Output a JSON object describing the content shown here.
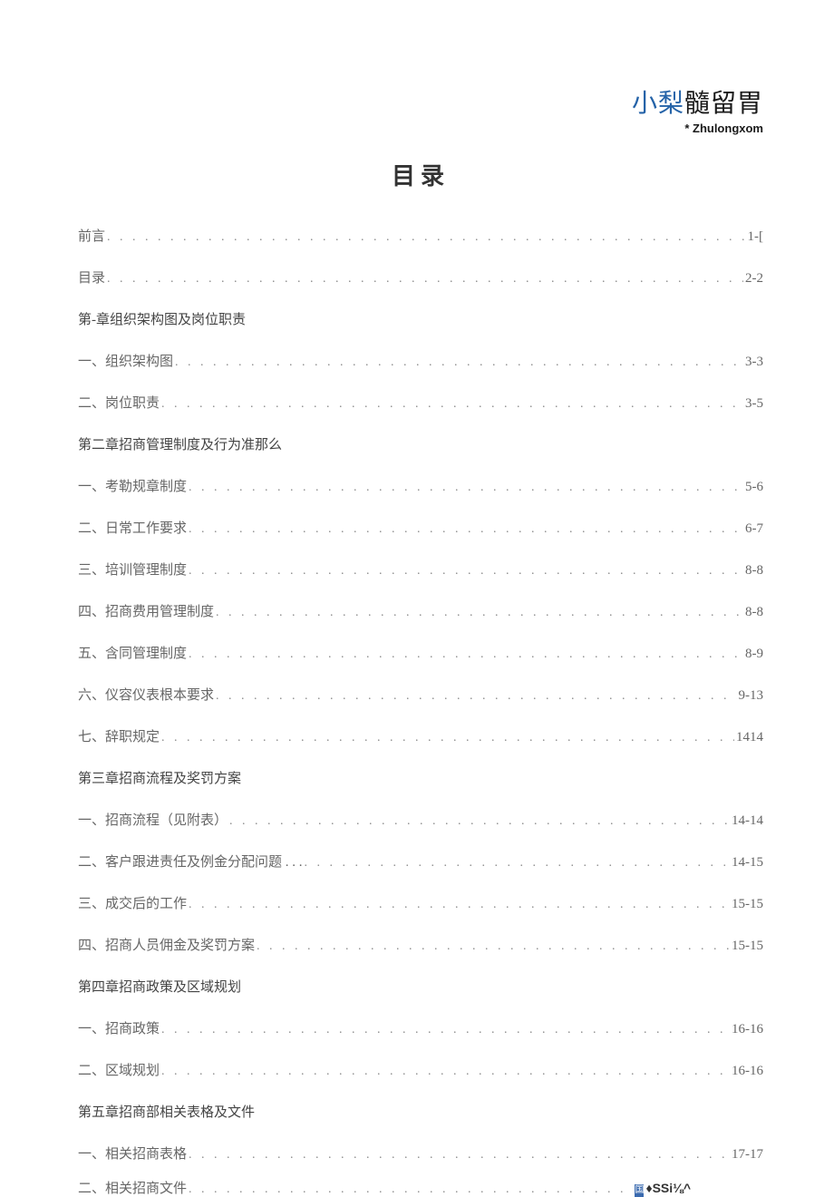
{
  "header": {
    "logo_blue": "小梨",
    "logo_black": "髓留胃",
    "logo_sub_prefix": "* ",
    "logo_sub": "Zhulongxom"
  },
  "title": "目录",
  "toc": [
    {
      "label": "前言",
      "page": "1-[",
      "has_dots": true
    },
    {
      "label": "目录",
      "page": "2-2",
      "has_dots": true
    },
    {
      "label": "第-章组织架构图及岗位职责",
      "page": "",
      "has_dots": false
    },
    {
      "label": "一、组织架构图",
      "page": "3-3",
      "has_dots": true
    },
    {
      "label": "二、岗位职责",
      "page": "3-5",
      "has_dots": true
    },
    {
      "label": "第二章招商管理制度及行为准那么",
      "page": "",
      "has_dots": false
    },
    {
      "label": "一、考勒规章制度",
      "page": "5-6",
      "has_dots": true
    },
    {
      "label": "二、日常工作要求",
      "page": "6-7",
      "has_dots": true
    },
    {
      "label": "三、培训管理制度",
      "page": "8-8",
      "has_dots": true
    },
    {
      "label": "四、招商费用管理制度",
      "page": "8-8",
      "has_dots": true
    },
    {
      "label": "五、含同管理制度",
      "page": "8-9",
      "has_dots": true
    },
    {
      "label": "六、仪容仪表根本要求",
      "page": "9-13",
      "has_dots": true
    },
    {
      "label": "七、辞职规定",
      "page": "1414",
      "has_dots": true
    },
    {
      "label": "第三章招商流程及奖罚方案",
      "page": "",
      "has_dots": false
    },
    {
      "label": "一、招商流程（见附表）",
      "page": "14-14",
      "has_dots": true
    },
    {
      "label": "二、客户跟进责任及例金分配问题 . . .   ",
      "page": "14-15",
      "has_dots": true
    },
    {
      "label": "三、成交后的工作",
      "page": "15-15",
      "has_dots": true
    },
    {
      "label": "四、招商人员佣金及奖罚方案",
      "page": "15-15",
      "has_dots": true
    },
    {
      "label": "第四章招商政策及区域规划",
      "page": "",
      "has_dots": false
    },
    {
      "label": "一、招商政策",
      "page": "16-16",
      "has_dots": true
    },
    {
      "label": "二、区域规划",
      "page": "16-16",
      "has_dots": true
    },
    {
      "label": "第五章招商部相关表格及文件",
      "page": "",
      "has_dots": false
    },
    {
      "label": "一、相关招商表格",
      "page": "17-17",
      "has_dots": true
    }
  ],
  "footer_row": {
    "label": "二、相关招商文件  ",
    "badge": "国",
    "suffix": "♦SSi⅛^"
  }
}
